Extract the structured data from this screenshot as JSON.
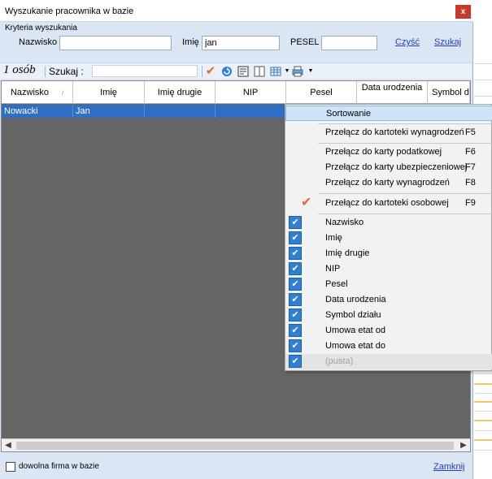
{
  "window": {
    "title": "Wyszukanie pracownika w bazie",
    "close_glyph": "x"
  },
  "criteria": {
    "group_label": "Kryteria wyszukania",
    "nazwisko_label": "Nazwisko",
    "nazwisko_value": "",
    "imie_label": "Imię",
    "imie_value": "jan",
    "pesel_label": "PESEL",
    "pesel_value": "",
    "clear_link": "Czyść",
    "search_link": "Szukaj"
  },
  "toolbar": {
    "count_label": "1 osób",
    "search_label": "Szukaj  :",
    "search_value": "",
    "icons": [
      "check-icon",
      "refresh-icon",
      "export-icon",
      "columns-icon",
      "grid-icon",
      "print-icon"
    ]
  },
  "table": {
    "columns": [
      "Nazwisko",
      "Imię",
      "Imię drugie",
      "NIP",
      "Pesel",
      "Data urodzenia",
      "Symbol dzi"
    ],
    "rows": [
      {
        "nazwisko": "Nowacki",
        "imie": "Jan",
        "imie_drugie": "",
        "nip": "",
        "pesel": "",
        "data_urodzenia": "",
        "symbol": ""
      }
    ]
  },
  "context_menu": {
    "sort_header": "Sortowanie",
    "items": [
      {
        "label": "Przełącz do kartoteki wynagrodzeń",
        "shortcut": "F5"
      },
      {
        "label": "Przełącz do karty podatkowej",
        "shortcut": "F6"
      },
      {
        "label": "Przełącz do karty ubezpieczeniowej",
        "shortcut": "F7"
      },
      {
        "label": "Przełącz do karty wynagrodzeń",
        "shortcut": "F8"
      },
      {
        "label": "Przełącz do kartoteki osobowej",
        "shortcut": "F9"
      }
    ],
    "column_toggles": [
      "Nazwisko",
      "Imię",
      "Imię drugie",
      "NIP",
      "Pesel",
      "Data urodzenia",
      "Symbol działu",
      "Umowa etat od",
      "Umowa etat do",
      "(pusta)"
    ],
    "check_glyph": "✔"
  },
  "footer": {
    "checkbox_label": "dowolna firma w bazie",
    "close_link": "Zamknij"
  },
  "colors": {
    "selection": "#2d6fc4",
    "grid_bg": "#656565",
    "menu_check": "#2f7fd4",
    "active_check": "#e26a2c"
  }
}
